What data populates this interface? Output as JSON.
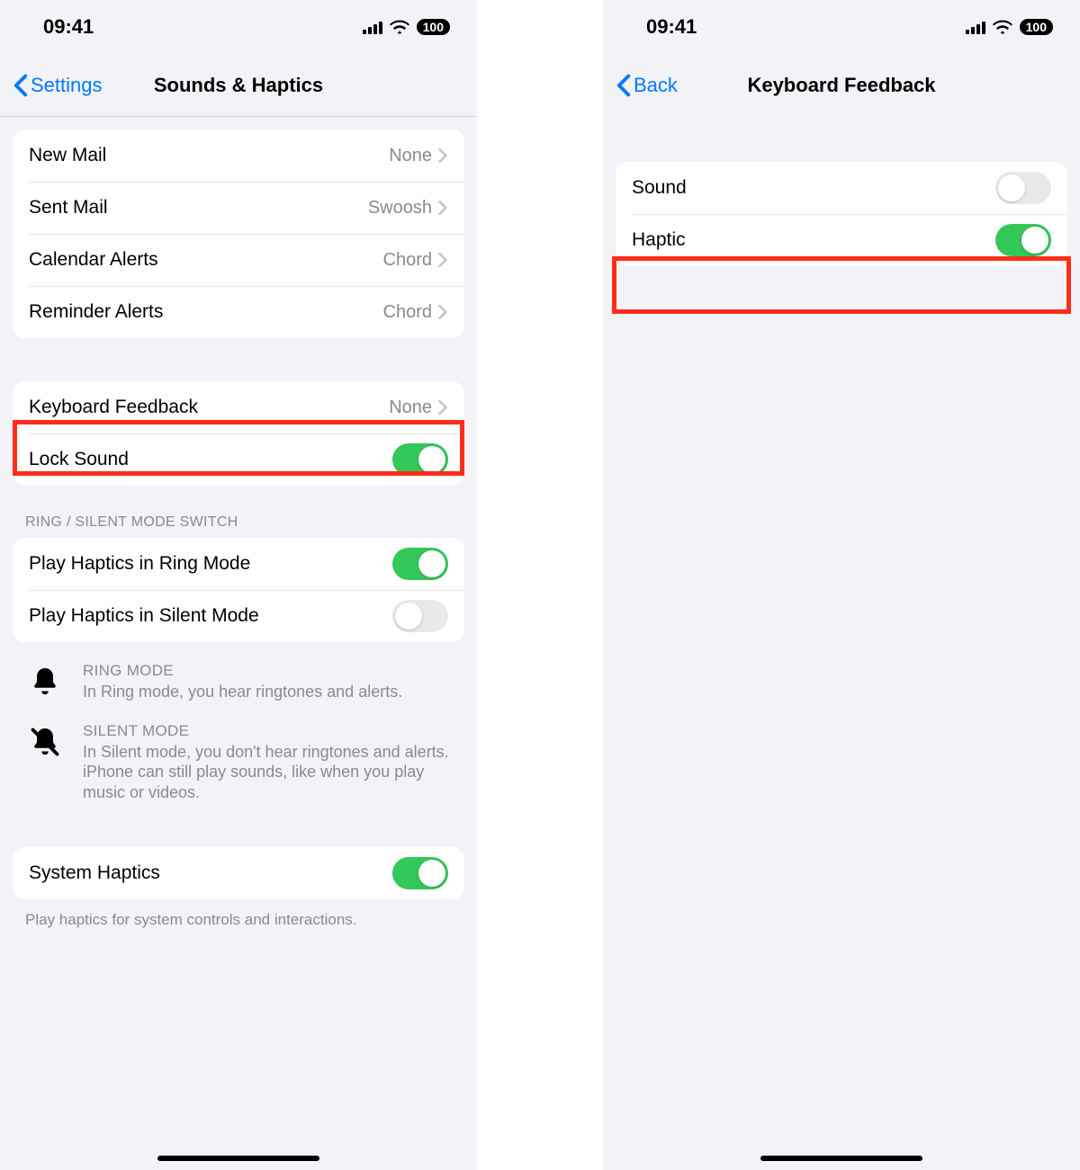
{
  "status": {
    "time": "09:41",
    "battery": "100"
  },
  "left": {
    "back": "Settings",
    "title": "Sounds & Haptics",
    "group1": [
      {
        "label": "New Mail",
        "value": "None"
      },
      {
        "label": "Sent Mail",
        "value": "Swoosh"
      },
      {
        "label": "Calendar Alerts",
        "value": "Chord"
      },
      {
        "label": "Reminder Alerts",
        "value": "Chord"
      }
    ],
    "group2": {
      "keyboard_feedback": {
        "label": "Keyboard Feedback",
        "value": "None"
      },
      "lock_sound": {
        "label": "Lock Sound"
      }
    },
    "group3_header": "RING / SILENT MODE SWITCH",
    "group3": {
      "ring": {
        "label": "Play Haptics in Ring Mode"
      },
      "silent": {
        "label": "Play Haptics in Silent Mode"
      }
    },
    "info_ring": {
      "title": "RING MODE",
      "body": "In Ring mode, you hear ringtones and alerts."
    },
    "info_silent": {
      "title": "SILENT MODE",
      "body": "In Silent mode, you don't hear ringtones and alerts. iPhone can still play sounds, like when you play music or videos."
    },
    "group4": {
      "system_haptics": {
        "label": "System Haptics"
      }
    },
    "footer": "Play haptics for system controls and interactions."
  },
  "right": {
    "back": "Back",
    "title": "Keyboard Feedback",
    "rows": {
      "sound": {
        "label": "Sound"
      },
      "haptic": {
        "label": "Haptic"
      }
    }
  }
}
